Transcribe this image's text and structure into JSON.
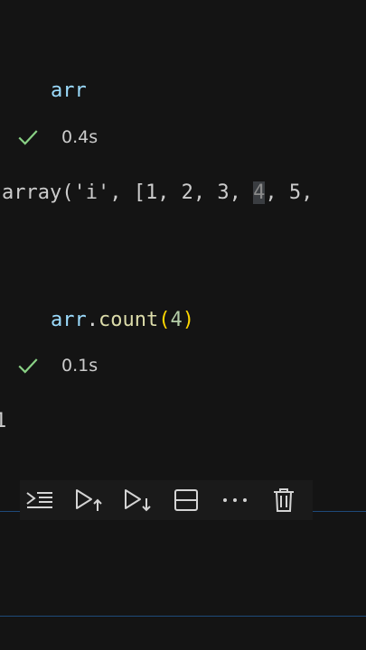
{
  "cells": [
    {
      "source": {
        "var": "arr"
      },
      "status": {
        "icon": "check-icon",
        "time": "0.4s"
      },
      "output": {
        "prefix": "array('i', [1, 2, 3, ",
        "highlight": "4",
        "suffix": ", 5,"
      }
    },
    {
      "source": {
        "var": "arr",
        "dot": ".",
        "method": "count",
        "open": "(",
        "arg": "4",
        "close": ")"
      },
      "status": {
        "icon": "check-icon",
        "time": "0.1s"
      },
      "output": {
        "text": "1"
      }
    }
  ],
  "toolbar": {
    "buttons": [
      {
        "icon": "run-by-line-icon"
      },
      {
        "icon": "execute-above-icon"
      },
      {
        "icon": "execute-below-icon"
      },
      {
        "icon": "split-cell-icon"
      },
      {
        "icon": "more-actions-icon"
      },
      {
        "icon": "delete-cell-icon"
      }
    ]
  },
  "colors": {
    "background": "#141414",
    "variable": "#9cdcfe",
    "method": "#dcdcaa",
    "number": "#b5cea8",
    "bracket": "#ffd700",
    "success": "#89d185",
    "focus_border": "#1e4a7a"
  }
}
